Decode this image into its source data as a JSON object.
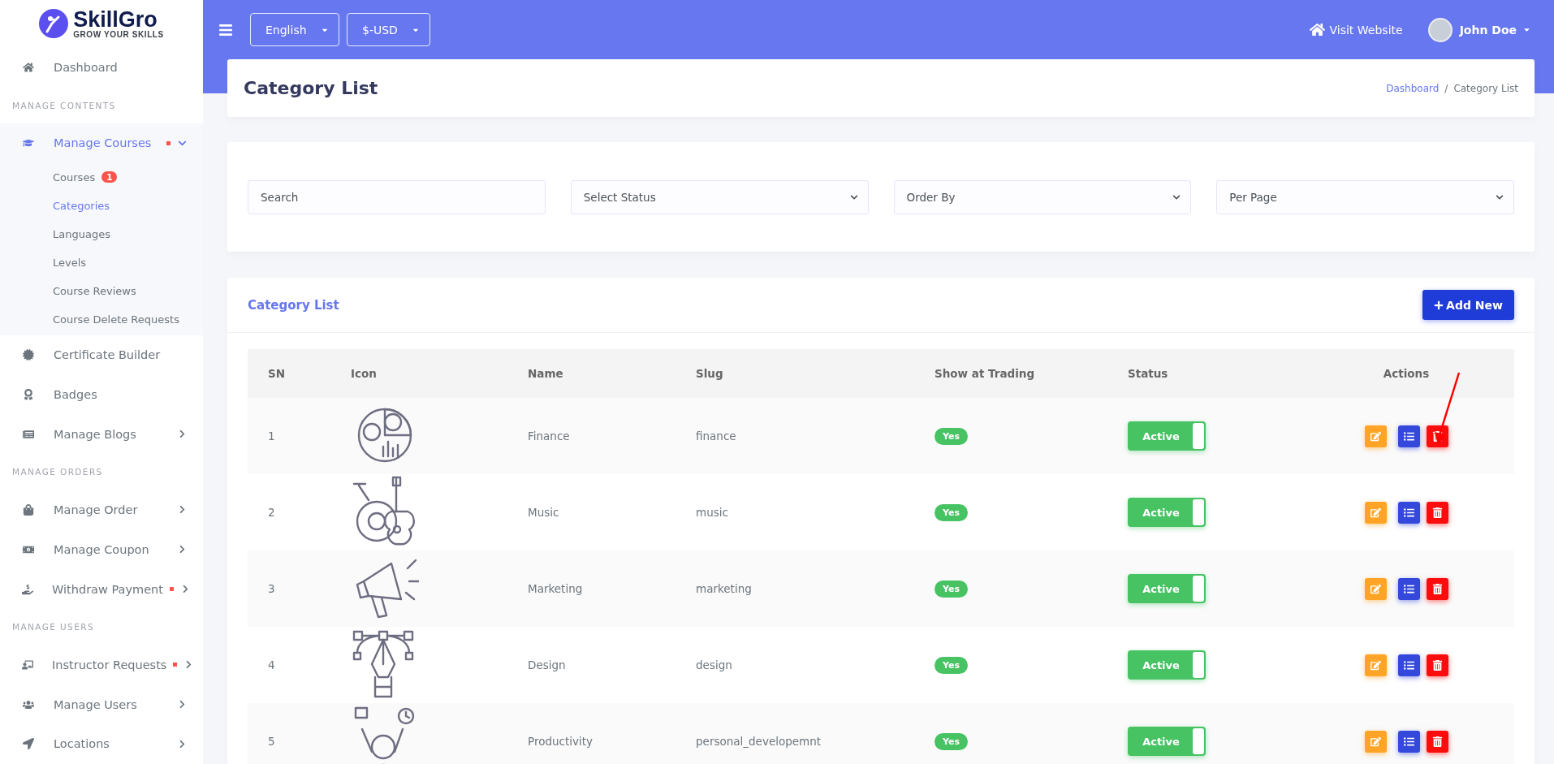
{
  "brand": {
    "name": "SkillGro",
    "tagline": "GROW YOUR SKILLS"
  },
  "sidebar": {
    "items": [
      {
        "kind": "link",
        "label": "Dashboard",
        "selected": false,
        "alert": false
      },
      {
        "kind": "section",
        "label": "MANAGE CONTENTS"
      },
      {
        "kind": "link",
        "label": "Manage Courses",
        "selected": true,
        "alert": true,
        "expanded": true,
        "children": [
          {
            "label": "Courses",
            "badge": "1",
            "selected": false
          },
          {
            "label": "Categories",
            "selected": true
          },
          {
            "label": "Languages",
            "selected": false
          },
          {
            "label": "Levels",
            "selected": false
          },
          {
            "label": "Course Reviews",
            "selected": false
          },
          {
            "label": "Course Delete Requests",
            "selected": false
          }
        ]
      },
      {
        "kind": "link",
        "label": "Certificate Builder",
        "selected": false,
        "alert": false
      },
      {
        "kind": "link",
        "label": "Badges",
        "selected": false,
        "alert": false
      },
      {
        "kind": "link",
        "label": "Manage Blogs",
        "selected": false,
        "alert": false,
        "expanded": false
      },
      {
        "kind": "section",
        "label": "MANAGE ORDERS"
      },
      {
        "kind": "link",
        "label": "Manage Order",
        "selected": false,
        "alert": false,
        "expanded": false
      },
      {
        "kind": "link",
        "label": "Manage Coupon",
        "selected": false,
        "alert": false,
        "expanded": false
      },
      {
        "kind": "link",
        "label": "Withdraw Payment",
        "selected": false,
        "alert": true,
        "expanded": false
      },
      {
        "kind": "section",
        "label": "MANAGE USERS"
      },
      {
        "kind": "link",
        "label": "Instructor Requests",
        "selected": false,
        "alert": true,
        "expanded": false
      },
      {
        "kind": "link",
        "label": "Manage Users",
        "selected": false,
        "alert": false,
        "expanded": false
      },
      {
        "kind": "link",
        "label": "Locations",
        "selected": false,
        "alert": false,
        "expanded": false
      }
    ]
  },
  "topbar": {
    "language": "English",
    "currency": "$-USD",
    "visit_link": "Visit Website",
    "user": "John Doe"
  },
  "page_header": {
    "title": "Category List",
    "breadcrumb": [
      "Dashboard",
      "Category List"
    ],
    "separator": "/"
  },
  "filters": {
    "search": {
      "placeholder": "Search"
    },
    "selects": [
      "Select Status",
      "Order By",
      "Per Page"
    ]
  },
  "table_card": {
    "title": "Category List",
    "add_button": "Add New"
  },
  "table": {
    "columns": [
      "SN",
      "Icon",
      "Name",
      "Slug",
      "Show at Trading",
      "Status",
      "Actions"
    ],
    "rows": [
      {
        "sn": "1",
        "name": "Finance",
        "slug": "finance",
        "show_at_trading": "Yes",
        "status": "Active",
        "status_on": true
      },
      {
        "sn": "2",
        "name": "Music",
        "slug": "music",
        "show_at_trading": "Yes",
        "status": "Active",
        "status_on": true
      },
      {
        "sn": "3",
        "name": "Marketing",
        "slug": "marketing",
        "show_at_trading": "Yes",
        "status": "Active",
        "status_on": true
      },
      {
        "sn": "4",
        "name": "Design",
        "slug": "design",
        "show_at_trading": "Yes",
        "status": "Active",
        "status_on": true
      },
      {
        "sn": "5",
        "name": "Productivity",
        "slug": "personal_developemnt",
        "show_at_trading": "Yes",
        "status": "Active",
        "status_on": true
      }
    ]
  }
}
